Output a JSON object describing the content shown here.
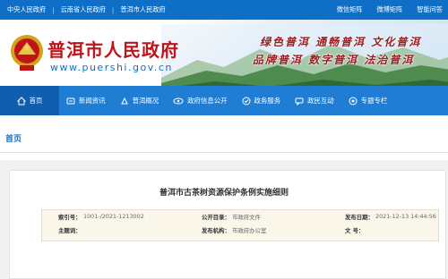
{
  "topbar": {
    "links": [
      "中央人民政府",
      "云南省人民政府",
      "普洱市人民政府"
    ],
    "right": [
      "微信矩阵",
      "微博矩阵",
      "智能问答"
    ]
  },
  "header": {
    "site_title": "普洱市人民政府",
    "site_url": "www.puershi.gov.cn",
    "slogan_line1": "绿色普洱  通畅普洱  文化普洱",
    "slogan_line2": "品牌普洱  数字普洱  法治普洱"
  },
  "nav": {
    "items": [
      {
        "label": "首页",
        "icon": "home-icon"
      },
      {
        "label": "新闻资讯",
        "icon": "news-icon"
      },
      {
        "label": "普洱概况",
        "icon": "overview-icon"
      },
      {
        "label": "政府信息公开",
        "icon": "eye-icon"
      },
      {
        "label": "政务服务",
        "icon": "service-icon"
      },
      {
        "label": "政民互动",
        "icon": "chat-icon"
      },
      {
        "label": "专题专栏",
        "icon": "topic-icon"
      }
    ]
  },
  "breadcrumb": {
    "home": "首页"
  },
  "article": {
    "title": "普洱市古茶树资源保护条例实施细则",
    "meta": {
      "index_label": "索引号：",
      "index_value": "1001-/2021-1213002",
      "catalog_label": "公开目录：",
      "catalog_value": "市政府文件",
      "date_label": "发布日期：",
      "date_value": "2021-12-13 14:44:56",
      "subject_label": "主题词：",
      "subject_value": "",
      "org_label": "发布机构：",
      "org_value": "市政府办公室",
      "docno_label": "文    号：",
      "docno_value": ""
    }
  },
  "colors": {
    "topbar": "#0f6fc6",
    "nav": "#1f7dd3",
    "nav_active": "#0f5fae",
    "title_red": "#c0141a",
    "breadcrumb": "#1f6fc2"
  }
}
